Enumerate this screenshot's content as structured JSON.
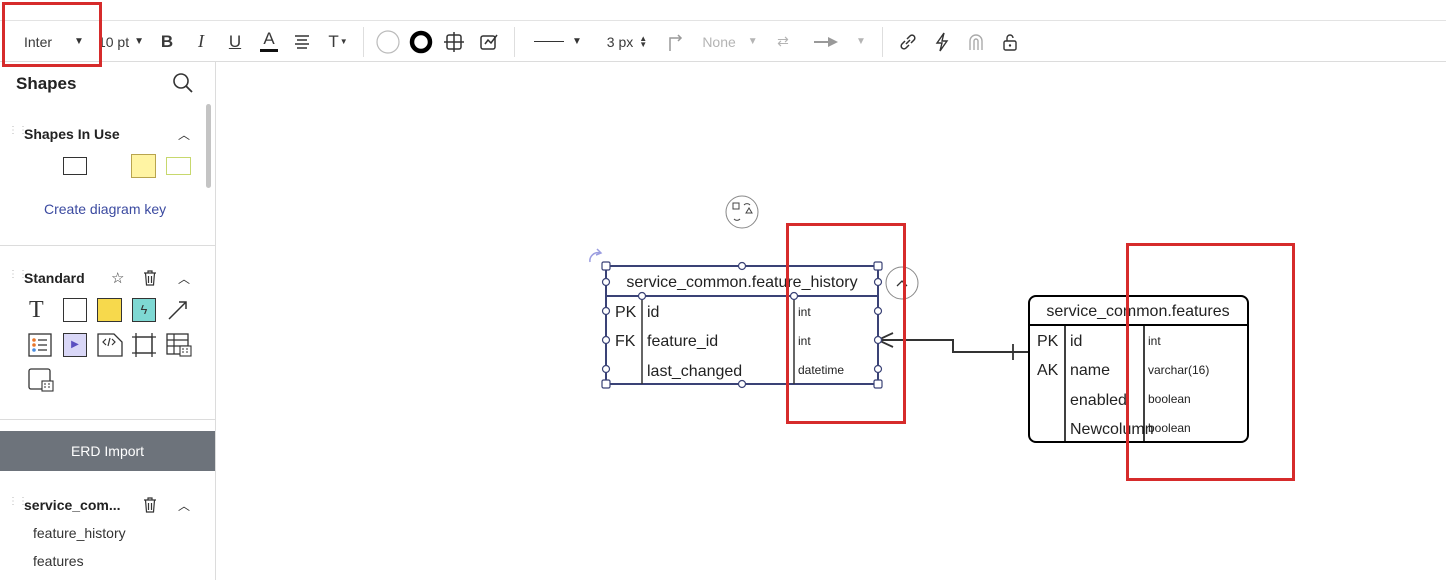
{
  "toolbar": {
    "font_family": "Inter",
    "font_size": "10 pt",
    "line_width": "3 px",
    "arrow_start": "None"
  },
  "shapes_panel": {
    "title": "Shapes",
    "in_use_title": "Shapes In Use",
    "create_key_label": "Create diagram key",
    "standard_title": "Standard",
    "erd_import_label": "ERD Import",
    "library_title": "service_com...",
    "library_items": [
      "feature_history",
      "features"
    ]
  },
  "diagram": {
    "table1": {
      "title": "service_common.feature_history",
      "rows": [
        {
          "key": "PK",
          "name": "id",
          "type": "int"
        },
        {
          "key": "FK",
          "name": "feature_id",
          "type": "int"
        },
        {
          "key": "",
          "name": "last_changed",
          "type": "datetime"
        }
      ]
    },
    "table2": {
      "title": "service_common.features",
      "rows": [
        {
          "key": "PK",
          "name": "id",
          "type": "int"
        },
        {
          "key": "AK",
          "name": "name",
          "type": "varchar(16)"
        },
        {
          "key": "",
          "name": "enabled",
          "type": "boolean"
        },
        {
          "key": "",
          "name": "Newcolumn",
          "type": "boolean"
        }
      ]
    }
  },
  "colors": {
    "highlight": "#d62b2b",
    "selection": "#3a4276",
    "accent_link": "#3b4aa0",
    "erd_button": "#6d737b"
  }
}
